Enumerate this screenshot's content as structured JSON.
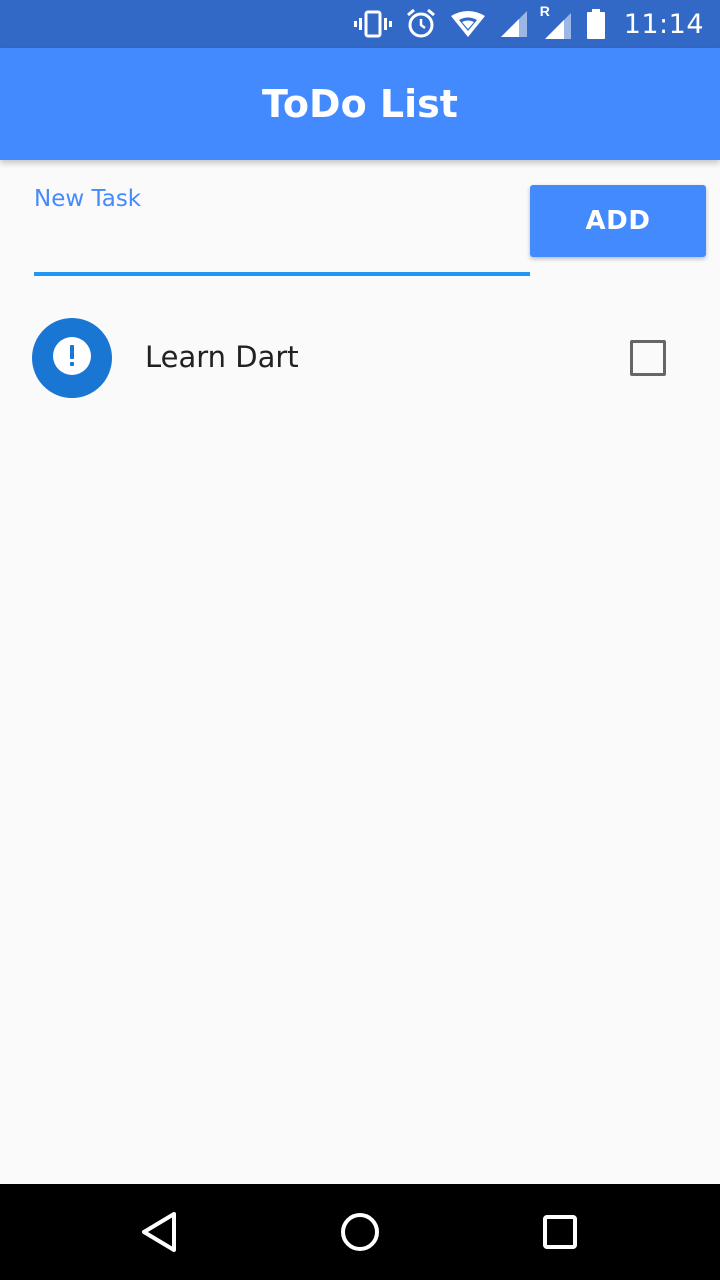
{
  "status_bar": {
    "time": "11:14",
    "background": "#3369c6",
    "icons": [
      "vibrate-icon",
      "alarm-icon",
      "wifi-icon",
      "cell-signal-icon",
      "roaming-signal-icon",
      "battery-icon"
    ],
    "roaming_label": "R"
  },
  "app_bar": {
    "title": "ToDo List",
    "background": "#448aff"
  },
  "new_task": {
    "label": "New Task",
    "value": "",
    "underline_color": "#2196f3"
  },
  "add_button": {
    "label": "ADD",
    "background": "#448aff"
  },
  "tasks": [
    {
      "text": "Learn Dart",
      "icon": "priority-alert-icon",
      "icon_glyph": "!",
      "avatar_color": "#1976d2",
      "checked": false
    }
  ],
  "nav_bar": {
    "buttons": [
      "back-icon",
      "home-icon",
      "recent-apps-icon"
    ]
  }
}
